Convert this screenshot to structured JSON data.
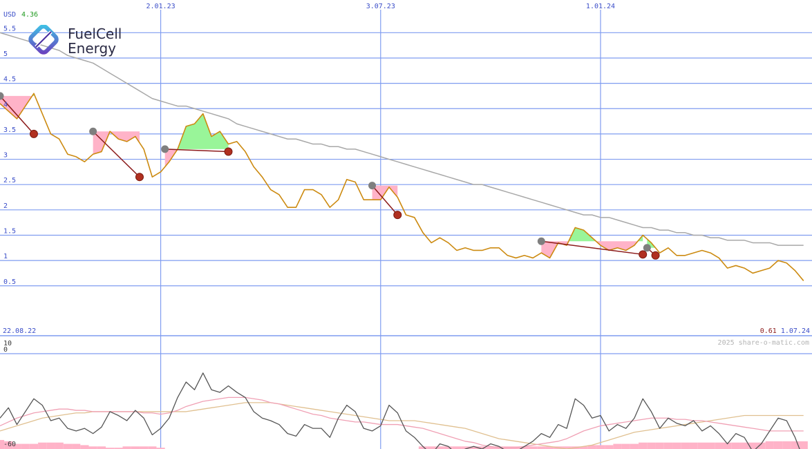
{
  "logo": {
    "line1": "FuelCell",
    "line2": "Energy"
  },
  "header": {
    "currency": "USD",
    "last_price": "4.36"
  },
  "footer": {
    "start_date": "22.08.22",
    "end_price": "0.61",
    "end_date": "1.07.24",
    "watermark": "2025 share-o-matic.com"
  },
  "colors": {
    "price": "#cc8a10",
    "trend": "#a8a8a8",
    "grid": "#7f9cf0",
    "gain_fill": "#99f599",
    "loss_fill": "#ffb3c8",
    "signal_line": "#8b1a1a",
    "marker_gray": "#7f7f7f",
    "marker_red": "#b03020"
  },
  "chart_data": [
    {
      "type": "line",
      "y_tick_labels": [
        "5.5",
        "5",
        "4.5",
        "4",
        "3.5",
        "3",
        "2.5",
        "2",
        "1.5",
        "1",
        "0.5"
      ],
      "y_ticks": [
        5.5,
        5,
        4.5,
        4,
        3.5,
        3,
        2.5,
        2,
        1.5,
        1,
        0.5
      ],
      "ylim": [
        0.06,
        5.6
      ],
      "x_tick_labels": [
        "2.01.23",
        "3.07.23",
        "1.01.24"
      ],
      "x_ticks": [
        19,
        45,
        71
      ],
      "xlim": [
        0,
        96
      ],
      "series": [
        {
          "values": [
            4.1,
            3.95,
            3.8,
            4.05,
            4.3,
            3.9,
            3.5,
            3.4,
            3.1,
            3.05,
            2.95,
            3.1,
            3.15,
            3.55,
            3.4,
            3.35,
            3.45,
            3.2,
            2.65,
            2.75,
            2.95,
            3.2,
            3.65,
            3.7,
            3.9,
            3.45,
            3.55,
            3.3,
            3.35,
            3.15,
            2.85,
            2.65,
            2.4,
            2.3,
            2.05,
            2.05,
            2.4,
            2.4,
            2.3,
            2.05,
            2.2,
            2.6,
            2.55,
            2.2,
            2.2,
            2.2,
            2.45,
            2.25,
            1.9,
            1.85,
            1.55,
            1.35,
            1.45,
            1.35,
            1.2,
            1.25,
            1.2,
            1.2,
            1.25,
            1.25,
            1.1,
            1.05,
            1.1,
            1.05,
            1.15,
            1.05,
            1.35,
            1.3,
            1.65,
            1.6,
            1.45,
            1.3,
            1.2,
            1.25,
            1.2,
            1.3,
            1.5,
            1.35,
            1.15,
            1.25,
            1.1,
            1.1,
            1.15,
            1.2,
            1.15,
            1.05,
            0.85,
            0.9,
            0.85,
            0.75,
            0.8,
            0.85,
            1.0,
            0.95,
            0.8,
            0.6
          ]
        },
        {
          "values": [
            5.5,
            5.45,
            5.4,
            5.35,
            5.3,
            5.25,
            5.2,
            5.15,
            5.05,
            5.0,
            4.95,
            4.9,
            4.8,
            4.7,
            4.6,
            4.5,
            4.4,
            4.3,
            4.2,
            4.15,
            4.1,
            4.05,
            4.05,
            4.0,
            3.95,
            3.9,
            3.85,
            3.8,
            3.7,
            3.65,
            3.6,
            3.55,
            3.5,
            3.45,
            3.4,
            3.4,
            3.35,
            3.3,
            3.3,
            3.25,
            3.25,
            3.2,
            3.2,
            3.15,
            3.1,
            3.05,
            3.0,
            2.95,
            2.9,
            2.85,
            2.8,
            2.75,
            2.7,
            2.65,
            2.6,
            2.55,
            2.5,
            2.5,
            2.45,
            2.4,
            2.35,
            2.3,
            2.25,
            2.2,
            2.15,
            2.1,
            2.05,
            2.0,
            1.95,
            1.9,
            1.9,
            1.85,
            1.85,
            1.8,
            1.75,
            1.7,
            1.65,
            1.65,
            1.6,
            1.6,
            1.55,
            1.55,
            1.5,
            1.5,
            1.45,
            1.45,
            1.4,
            1.4,
            1.4,
            1.35,
            1.35,
            1.35,
            1.3,
            1.3,
            1.3,
            1.3
          ]
        }
      ],
      "signals": [
        {
          "from_x": 0,
          "from_y": 4.25,
          "to_x": 4,
          "to_y": 3.5
        },
        {
          "from_x": 11,
          "from_y": 3.55,
          "to_x": 16.5,
          "to_y": 2.65
        },
        {
          "from_x": 19.5,
          "from_y": 3.2,
          "to_x": 27,
          "to_y": 3.15
        },
        {
          "from_x": 44,
          "from_y": 2.48,
          "to_x": 47,
          "to_y": 1.9
        },
        {
          "from_x": 64,
          "from_y": 1.38,
          "to_x": 76,
          "to_y": 1.12
        },
        {
          "from_x": 76.5,
          "from_y": 1.25,
          "to_x": 77.5,
          "to_y": 1.1
        }
      ]
    },
    {
      "type": "line",
      "y_tick_labels": [
        "10",
        "0",
        "-60"
      ],
      "y_ticks": [
        10,
        0,
        -60
      ],
      "ylim": [
        -64,
        10
      ],
      "xlim": [
        0,
        96
      ],
      "series": [
        {
          "values": [
            -40,
            -32,
            -45,
            -35,
            -25,
            -30,
            -42,
            -40,
            -48,
            -50,
            -48,
            -52,
            -47,
            -35,
            -38,
            -42,
            -34,
            -40,
            -53,
            -48,
            -40,
            -24,
            -12,
            -18,
            -5,
            -18,
            -20,
            -15,
            -20,
            -24,
            -35,
            -40,
            -42,
            -45,
            -52,
            -54,
            -45,
            -48,
            -48,
            -55,
            -40,
            -30,
            -35,
            -48,
            -50,
            -46,
            -30,
            -36,
            -50,
            -55,
            -62,
            -68,
            -60,
            -62,
            -68,
            -64,
            -62,
            -64,
            -60,
            -62,
            -66,
            -66,
            -62,
            -58,
            -52,
            -55,
            -45,
            -48,
            -25,
            -30,
            -40,
            -38,
            -50,
            -45,
            -48,
            -40,
            -25,
            -35,
            -48,
            -40,
            -44,
            -46,
            -42,
            -50,
            -46,
            -52,
            -60,
            -52,
            -55,
            -66,
            -60,
            -50,
            -40,
            -42,
            -55,
            -72
          ]
        },
        {
          "values": [
            -46,
            -43,
            -40,
            -38,
            -36,
            -35,
            -34,
            -33,
            -33,
            -34,
            -34,
            -35,
            -35,
            -35,
            -35,
            -35,
            -35,
            -36,
            -36,
            -37,
            -36,
            -34,
            -31,
            -29,
            -27,
            -26,
            -25,
            -24,
            -24,
            -24,
            -25,
            -26,
            -28,
            -29,
            -31,
            -33,
            -35,
            -37,
            -38,
            -40,
            -41,
            -42,
            -43,
            -43,
            -44,
            -45,
            -45,
            -45,
            -46,
            -47,
            -48,
            -50,
            -52,
            -54,
            -56,
            -58,
            -59,
            -61,
            -62,
            -63,
            -63,
            -63,
            -62,
            -61,
            -60,
            -59,
            -58,
            -56,
            -53,
            -50,
            -48,
            -46,
            -45,
            -44,
            -43,
            -42,
            -41,
            -40,
            -40,
            -40,
            -41,
            -41,
            -42,
            -42,
            -43,
            -44,
            -45,
            -46,
            -47,
            -48,
            -49,
            -50,
            -50,
            -50,
            -50,
            -50
          ]
        },
        {
          "values": [
            -50,
            -48,
            -46,
            -44,
            -42,
            -40,
            -39,
            -38,
            -37,
            -36,
            -36,
            -35,
            -35,
            -35,
            -35,
            -35,
            -35,
            -35,
            -35,
            -35,
            -35,
            -35,
            -35,
            -34,
            -33,
            -32,
            -31,
            -30,
            -29,
            -28,
            -28,
            -28,
            -28,
            -29,
            -30,
            -31,
            -32,
            -33,
            -34,
            -35,
            -36,
            -37,
            -38,
            -39,
            -40,
            -41,
            -42,
            -42,
            -42,
            -42,
            -43,
            -44,
            -45,
            -46,
            -47,
            -48,
            -50,
            -52,
            -54,
            -56,
            -57,
            -58,
            -59,
            -60,
            -61,
            -62,
            -63,
            -64,
            -63,
            -62,
            -61,
            -59,
            -57,
            -55,
            -53,
            -51,
            -50,
            -49,
            -48,
            -47,
            -46,
            -45,
            -44,
            -43,
            -42,
            -41,
            -40,
            -39,
            -38,
            -38,
            -38,
            -38,
            -38,
            -38,
            -38,
            -38
          ]
        },
        {
          "values": [
            -57,
            -58,
            -60,
            -60,
            -60,
            -59,
            -59,
            -59,
            -60,
            -60,
            -61,
            -62,
            -62,
            -63,
            -63,
            -62,
            -62,
            -62,
            -62,
            -63,
            -64,
            -64,
            -64,
            -64,
            -64,
            -64,
            -64,
            -64,
            -64,
            -64,
            -64,
            -64,
            -64,
            -64,
            -64,
            -64,
            -64,
            -64,
            -64,
            -64,
            -64,
            -64,
            -64,
            -64,
            -64,
            -64,
            -64,
            -64,
            -64,
            -64,
            -62,
            -62,
            -62,
            -62,
            -62,
            -62,
            -62,
            -62,
            -62,
            -62,
            -62,
            -62,
            -62,
            -62,
            -62,
            -62,
            -62,
            -62,
            -62,
            -62,
            -61,
            -61,
            -61,
            -60,
            -60,
            -60,
            -59,
            -59,
            -59,
            -59,
            -59,
            -59,
            -59,
            -59,
            -59,
            -59,
            -59,
            -59,
            -59,
            -59,
            -59,
            -58,
            -58,
            -58,
            -58,
            -58
          ]
        }
      ]
    }
  ]
}
